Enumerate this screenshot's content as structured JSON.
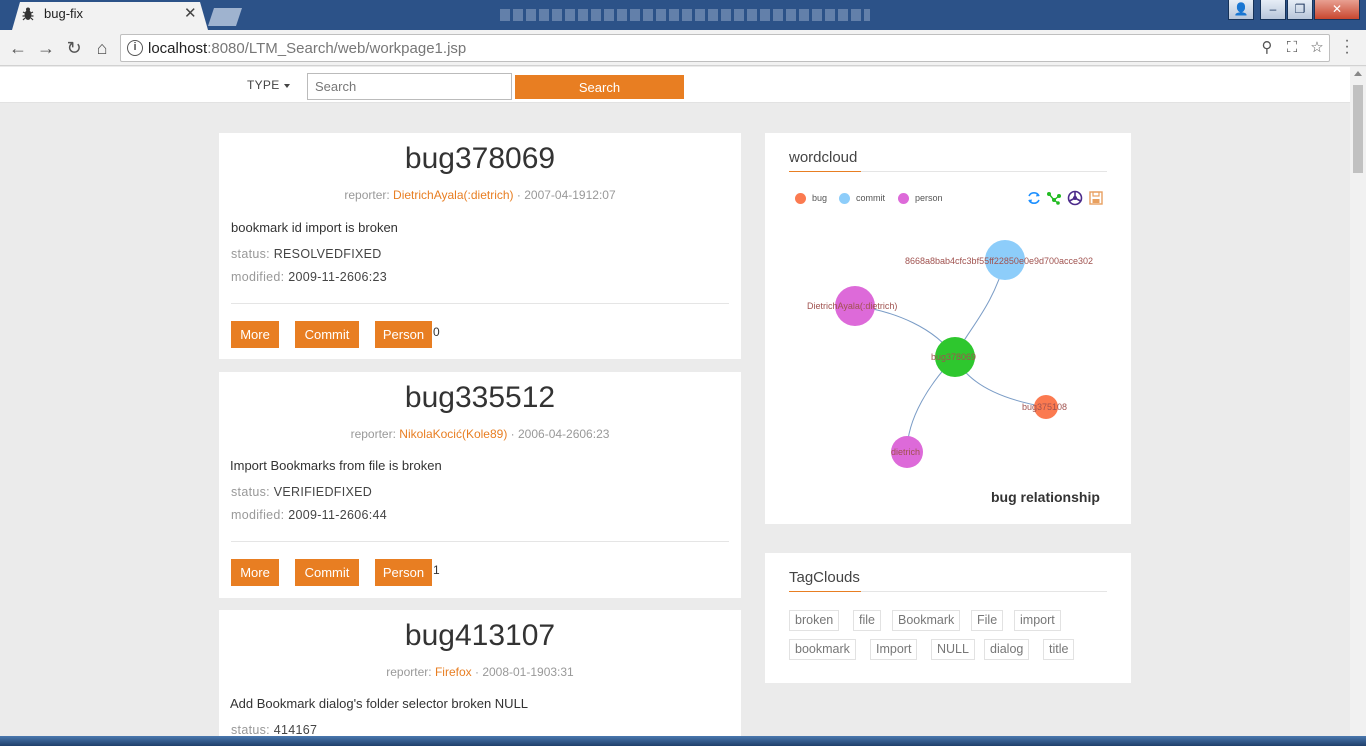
{
  "browser": {
    "tab_title": "bug-fix",
    "url_host": "localhost",
    "url_path": ":8080/LTM_Search/web/workpage1.jsp"
  },
  "nav": {
    "type_label": "TYPE",
    "search_placeholder": "Search",
    "search_button": "Search"
  },
  "bugs": [
    {
      "id": "bug378069",
      "reporter_label": "reporter:",
      "reporter": "DietrichAyala(:dietrich)",
      "date": "· 2007-04-1912:07",
      "summary": "bookmark id import is broken",
      "status_label": "status:",
      "status": "RESOLVEDFIXED",
      "modified_label": "modified:",
      "modified": "2009-11-2606:23",
      "buttons": [
        "More",
        "Commit",
        "Person"
      ],
      "count": "0"
    },
    {
      "id": "bug335512",
      "reporter_label": "reporter:",
      "reporter": "NikolaKocić(Kole89)",
      "date": "· 2006-04-2606:23",
      "summary": "Import Bookmarks from file is broken",
      "status_label": "status:",
      "status": "VERIFIEDFIXED",
      "modified_label": "modified:",
      "modified": "2009-11-2606:44",
      "buttons": [
        "More",
        "Commit",
        "Person"
      ],
      "count": "1"
    },
    {
      "id": "bug413107",
      "reporter_label": "reporter:",
      "reporter": "Firefox",
      "date": "· 2008-01-1903:31",
      "summary": "Add Bookmark dialog's folder selector broken NULL",
      "status_label": "status:",
      "status": "414167"
    }
  ],
  "wordcloud": {
    "title": "wordcloud",
    "legend": [
      {
        "label": "bug",
        "color": "#fb7a50"
      },
      {
        "label": "commit",
        "color": "#8dcdfa"
      },
      {
        "label": "person",
        "color": "#dd6ad9"
      }
    ],
    "tools": [
      "refresh-icon",
      "graph-layout-icon",
      "force-icon",
      "save-image-icon"
    ],
    "nodes": [
      {
        "label": "bug378069",
        "type": "bug-center",
        "color": "#2ec72e"
      },
      {
        "label": "8668a8bab4cfc3bf55ff22850e0e9d700acce302",
        "type": "commit",
        "color": "#8dcdfa"
      },
      {
        "label": "DietrichAyala(:dietrich)",
        "type": "person",
        "color": "#dd6ad9"
      },
      {
        "label": "bug375108",
        "type": "bug",
        "color": "#fb7a50"
      },
      {
        "label": "dietrich",
        "type": "person",
        "color": "#dd6ad9"
      }
    ],
    "caption": "bug relationship"
  },
  "tagclouds": {
    "title": "TagClouds",
    "tags": [
      "broken",
      "file",
      "Bookmark",
      "File",
      "import",
      "bookmark",
      "Import",
      "NULL",
      "dialog",
      "title"
    ]
  }
}
